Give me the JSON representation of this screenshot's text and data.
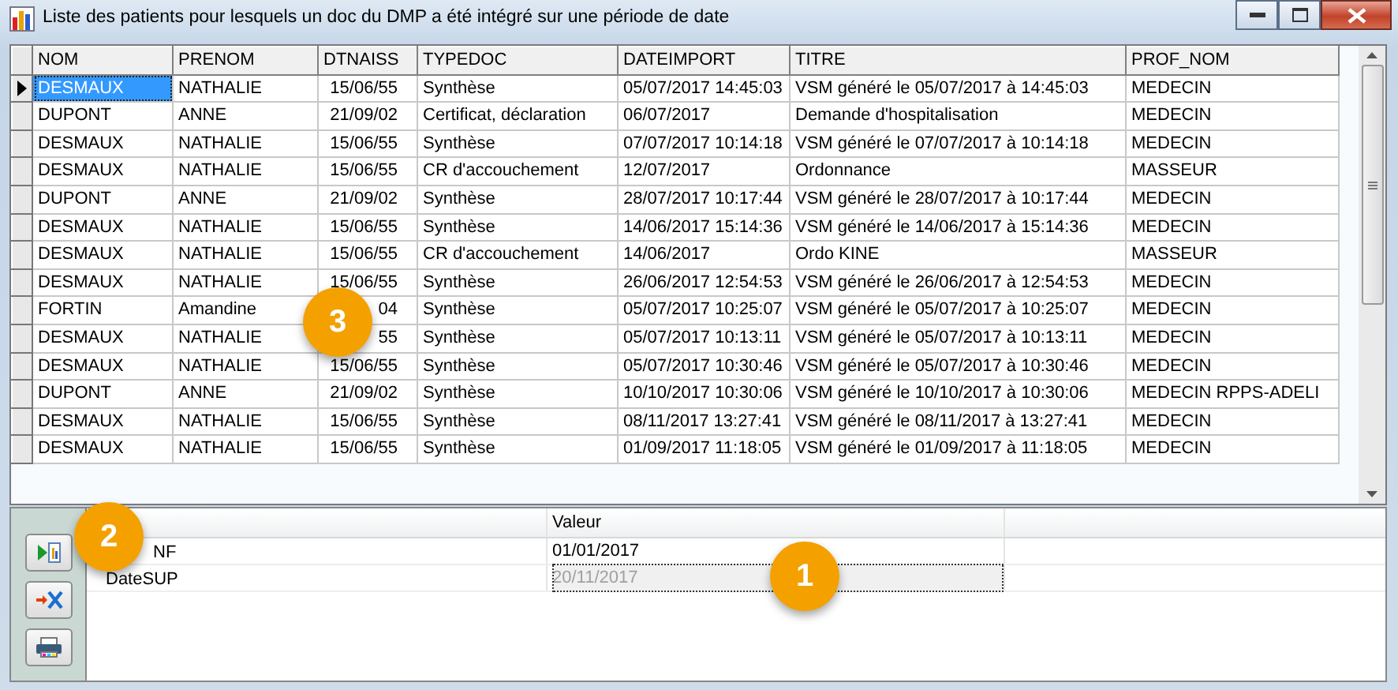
{
  "window": {
    "title": "Liste des patients pour lesquels un doc du DMP a été intégré sur une période de date"
  },
  "table": {
    "columns": [
      "NOM",
      "PRENOM",
      "DTNAISS",
      "TYPEDOC",
      "DATEIMPORT",
      "TITRE",
      "PROF_NOM"
    ],
    "rows": [
      {
        "selected": true,
        "cells": [
          "DESMAUX",
          "NATHALIE",
          "15/06/55",
          "Synthèse",
          "05/07/2017 14:45:03",
          "VSM généré le 05/07/2017 à 14:45:03",
          "MEDECIN"
        ]
      },
      {
        "selected": false,
        "cells": [
          "DUPONT",
          "ANNE",
          "21/09/02",
          "Certificat, déclaration",
          "06/07/2017",
          "Demande d'hospitalisation",
          "MEDECIN"
        ]
      },
      {
        "selected": false,
        "cells": [
          "DESMAUX",
          "NATHALIE",
          "15/06/55",
          "Synthèse",
          "07/07/2017 10:14:18",
          "VSM généré le 07/07/2017 à 10:14:18",
          "MEDECIN"
        ]
      },
      {
        "selected": false,
        "cells": [
          "DESMAUX",
          "NATHALIE",
          "15/06/55",
          "CR d'accouchement",
          "12/07/2017",
          "Ordonnance",
          "MASSEUR"
        ]
      },
      {
        "selected": false,
        "cells": [
          "DUPONT",
          "ANNE",
          "21/09/02",
          "Synthèse",
          "28/07/2017 10:17:44",
          "VSM généré le 28/07/2017 à 10:17:44",
          "MEDECIN"
        ]
      },
      {
        "selected": false,
        "cells": [
          "DESMAUX",
          "NATHALIE",
          "15/06/55",
          "Synthèse",
          "14/06/2017 15:14:36",
          "VSM généré le 14/06/2017 à 15:14:36",
          "MEDECIN"
        ]
      },
      {
        "selected": false,
        "cells": [
          "DESMAUX",
          "NATHALIE",
          "15/06/55",
          "CR d'accouchement",
          "14/06/2017",
          "Ordo KINE",
          "MASSEUR"
        ]
      },
      {
        "selected": false,
        "cells": [
          "DESMAUX",
          "NATHALIE",
          "15/06/55",
          "Synthèse",
          "26/06/2017 12:54:53",
          "VSM généré le 26/06/2017 à 12:54:53",
          "MEDECIN"
        ]
      },
      {
        "selected": false,
        "cells": [
          "FORTIN",
          "Amandine",
          "04",
          "Synthèse",
          "05/07/2017 10:25:07",
          "VSM généré le 05/07/2017 à 10:25:07",
          "MEDECIN"
        ]
      },
      {
        "selected": false,
        "cells": [
          "DESMAUX",
          "NATHALIE",
          "55",
          "Synthèse",
          "05/07/2017 10:13:11",
          "VSM généré le 05/07/2017 à 10:13:11",
          "MEDECIN"
        ]
      },
      {
        "selected": false,
        "cells": [
          "DESMAUX",
          "NATHALIE",
          "15/06/55",
          "Synthèse",
          "05/07/2017 10:30:46",
          "VSM généré le 05/07/2017 à 10:30:46",
          "MEDECIN"
        ]
      },
      {
        "selected": false,
        "cells": [
          "DUPONT",
          "ANNE",
          "21/09/02",
          "Synthèse",
          "10/10/2017 10:30:06",
          "VSM généré le 10/10/2017 à 10:30:06",
          "MEDECIN RPPS-ADELI"
        ]
      },
      {
        "selected": false,
        "cells": [
          "DESMAUX",
          "NATHALIE",
          "15/06/55",
          "Synthèse",
          "08/11/2017 13:27:41",
          "VSM généré le 08/11/2017 à 13:27:41",
          "MEDECIN"
        ]
      },
      {
        "selected": false,
        "cells": [
          "DESMAUX",
          "NATHALIE",
          "15/06/55",
          "Synthèse",
          "01/09/2017 11:18:05",
          "VSM généré le 01/09/2017 à 11:18:05",
          "MEDECIN"
        ]
      }
    ]
  },
  "parameters": {
    "value_header": "Valeur",
    "rows": [
      {
        "label": "NF",
        "value": "01/01/2017",
        "disabled": false
      },
      {
        "label": "DateSUP",
        "value": "20/11/2017",
        "disabled": true
      }
    ]
  },
  "callouts": [
    {
      "label": "3"
    },
    {
      "label": "2"
    },
    {
      "label": "1"
    }
  ]
}
